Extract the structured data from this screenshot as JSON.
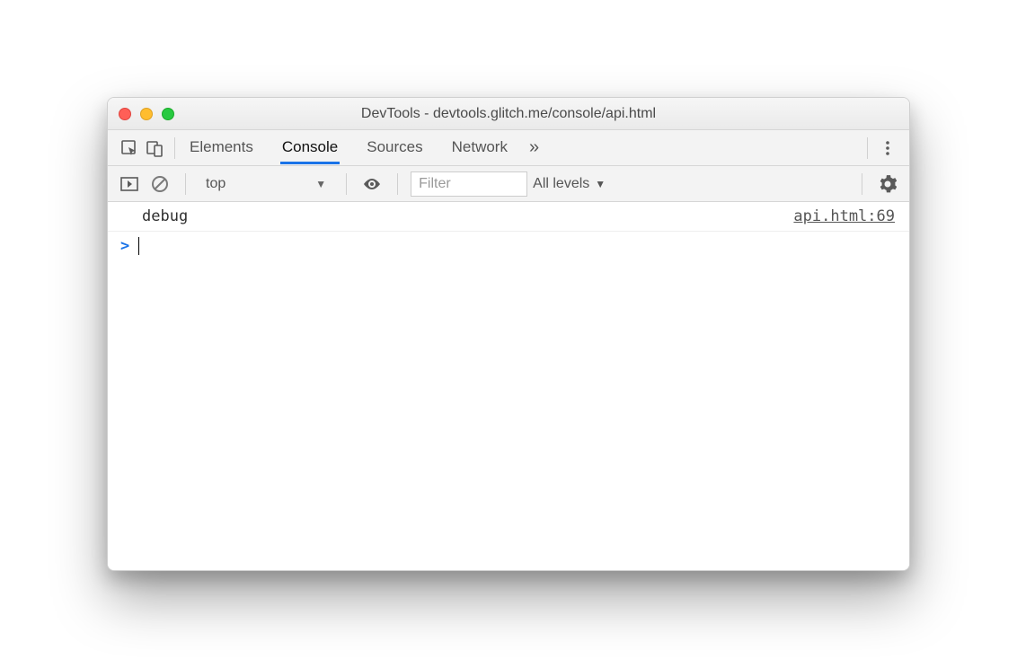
{
  "window": {
    "title": "DevTools - devtools.glitch.me/console/api.html"
  },
  "tabs": {
    "items": [
      "Elements",
      "Console",
      "Sources",
      "Network"
    ],
    "active_index": 1,
    "more": "»"
  },
  "toolbar": {
    "context": "top",
    "filter_placeholder": "Filter",
    "levels_label": "All levels"
  },
  "console": {
    "logs": [
      {
        "message": "debug",
        "source": "api.html:69"
      }
    ],
    "prompt": ">"
  }
}
